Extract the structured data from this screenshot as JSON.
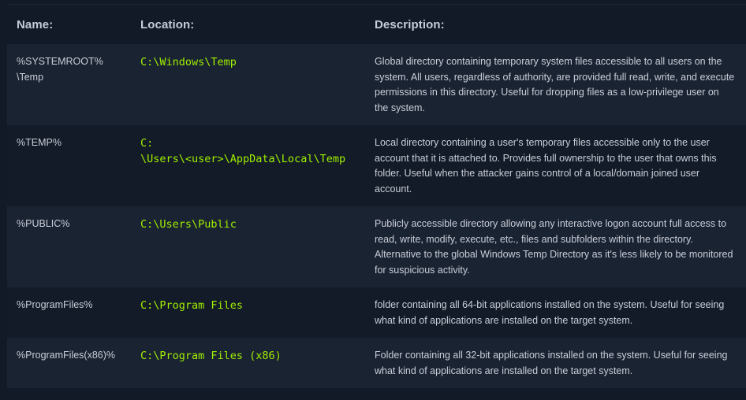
{
  "table": {
    "headers": {
      "name": "Name:",
      "location": "Location:",
      "description": "Description:"
    },
    "rows": [
      {
        "name_line1": "%SYSTEMROOT%",
        "name_line2": "\\Temp",
        "location": "C:\\Windows\\Temp",
        "description": "Global directory containing temporary system files accessible to all users on the system. All users, regardless of authority, are provided full read, write, and execute permissions in this directory. Useful for dropping files as a low-privilege user on the system."
      },
      {
        "name_line1": "%TEMP%",
        "name_line2": "",
        "location_line1": "C:",
        "location_line2": "\\Users\\<user>\\AppData\\Local\\Temp",
        "description": "Local directory containing a user's temporary files accessible only to the user account that it is attached to. Provides full ownership to the user that owns this folder. Useful when the attacker gains control of a local/domain joined user account."
      },
      {
        "name_line1": "%PUBLIC%",
        "name_line2": "",
        "location": "C:\\Users\\Public",
        "description": "Publicly accessible directory allowing any interactive logon account full access to read, write, modify, execute, etc., files and subfolders within the directory. Alternative to the global Windows Temp Directory as it's less likely to be monitored for suspicious activity."
      },
      {
        "name_line1": "%ProgramFiles%",
        "name_line2": "",
        "location": "C:\\Program Files",
        "description": "folder containing all 64-bit applications installed on the system. Useful for seeing what kind of applications are installed on the target system."
      },
      {
        "name_line1": "%ProgramFiles(x86)%",
        "name_line2": "",
        "location": "C:\\Program Files (x86)",
        "description": "Folder containing all 32-bit applications installed on the system. Useful for seeing what kind of applications are installed on the target system."
      }
    ]
  },
  "colors": {
    "background": "#121927",
    "row_odd": "#1a2332",
    "row_even": "#131b28",
    "path_accent": "#9fef00",
    "text": "#c9ced8"
  }
}
